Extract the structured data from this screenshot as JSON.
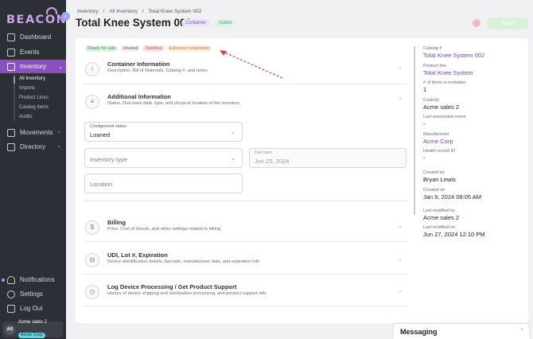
{
  "app": {
    "logo_text": "BEACON",
    "collapse_glyph": "‹"
  },
  "sidebar": {
    "items": [
      {
        "label": "Dashboard",
        "icon": "dashboard-icon"
      },
      {
        "label": "Events",
        "icon": "calendar-icon"
      },
      {
        "label": "Inventory",
        "icon": "inventory-icon",
        "active": true,
        "chevron": "⌄"
      },
      {
        "label": "Movements",
        "icon": "arrows-icon",
        "chevron": "›"
      },
      {
        "label": "Directory",
        "icon": "book-icon",
        "chevron": "›"
      },
      {
        "label": "Notifications",
        "icon": "bell-icon"
      },
      {
        "label": "Settings",
        "icon": "gear-icon"
      },
      {
        "label": "Log Out",
        "icon": "logout-icon"
      }
    ],
    "inventory_sub": [
      "All Inventory",
      "Imports",
      "Product Lines",
      "Catalog Items",
      "Audits"
    ],
    "user": {
      "initials": "AS",
      "name": "Acme sales 2",
      "org": "Acme Corp"
    }
  },
  "header": {
    "breadcrumb": [
      "Inventory",
      "All Inventory",
      "Total Knee System 002"
    ],
    "breadcrumb_sep": "/",
    "title": "Total Knee System 002",
    "chips": [
      "Container",
      "Active"
    ],
    "save_label": "Save"
  },
  "tags": [
    "Ready for sale",
    "Unused",
    "Overdue",
    "Extension requested"
  ],
  "sections": {
    "container": {
      "title": "Container Information",
      "desc": "Description, Bill of Materials, Catalog #, and notes",
      "icon_glyph": "i",
      "chevron": "⌄"
    },
    "additional": {
      "title": "Additional Information",
      "desc": "Status, Due back date, type, and physical location of the inventory",
      "icon_glyph": "≡",
      "chevron": "⌃"
    },
    "billing": {
      "title": "Billing",
      "desc": "Price, Cost of Goods, and other settings related to billing",
      "icon_glyph": "$",
      "chevron": "⌄"
    },
    "udi": {
      "title": "UDI, Lot #, Expiration",
      "desc": "Device identification details, barcode, manufacturer date, and expiration info",
      "icon_glyph": "⊟",
      "chevron": "⌄"
    },
    "log": {
      "title": "Log Device Processing / Get Product Support",
      "desc": "History of device shipping and sterilization processing, and product support info",
      "icon_glyph": "◷",
      "chevron": "⌄"
    }
  },
  "fields": {
    "consignment": {
      "label": "Consignment status",
      "value": "Loaned",
      "chevron": "⌄"
    },
    "inventory_type": {
      "placeholder": "Inventory type",
      "chevron": "⌄"
    },
    "due_back": {
      "label": "Due back",
      "value": "Jun 25, 2024"
    },
    "location": {
      "placeholder": "Location"
    }
  },
  "details": {
    "catalog_label": "Catalog #",
    "catalog_value": "Total Knee System 002",
    "product_line_label": "Product line",
    "product_line_value": "Total Knee System",
    "items_label": "# of items in container",
    "items_value": "1",
    "custody_label": "Custody",
    "custody_value": "Acme sales 2",
    "last_event_label": "Last associated event",
    "last_event_value": "-",
    "manufacturer_label": "Manufacturer",
    "manufacturer_value": "Acme Corp",
    "health_label": "Health record ID",
    "health_value": "-",
    "created_by_label": "Created by",
    "created_by_value": "Bryan Lewis",
    "created_on_label": "Created on",
    "created_on_value": "Jan 9, 2024 08:05 AM",
    "modified_by_label": "Last modified by",
    "modified_by_value": "Acme sales 2",
    "modified_on_label": "Last modified on",
    "modified_on_value": "Jun 27, 2024 12:10 PM"
  },
  "messaging": {
    "title": "Messaging",
    "chevron": "⌃"
  },
  "colors": {
    "sidebar_bg": "#2d2f36",
    "accent": "#8a4fc0",
    "link": "#7b3fb5",
    "annotation_arrow": "#c84a4a"
  }
}
